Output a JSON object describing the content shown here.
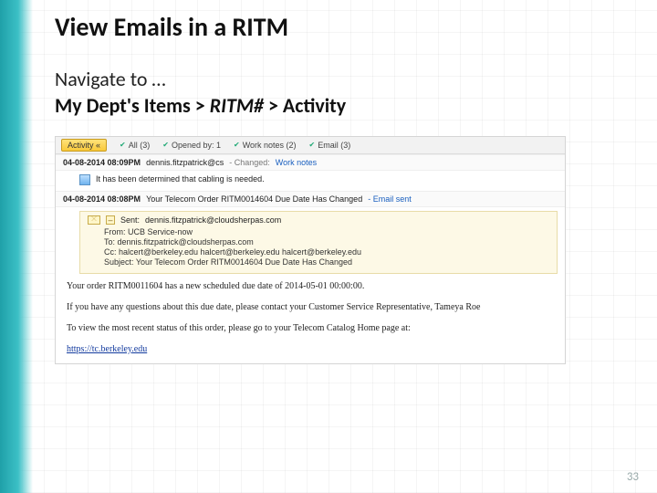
{
  "slide": {
    "title": "View Emails in a RITM",
    "nav_label": "Navigate to …",
    "nav_path_prefix": "My Dept's Items > ",
    "nav_path_italic": "RITM#",
    "nav_path_suffix": " > Activity",
    "page_number": "33"
  },
  "activity_header": {
    "button": "Activity «",
    "filters": [
      "All (3)",
      "Opened by: 1",
      "Work notes (2)",
      "Email (3)"
    ]
  },
  "entry1": {
    "timestamp": "04-08-2014 08:09PM",
    "user": "dennis.fitzpatrick@cs",
    "tag_prefix": "- Changed:",
    "tag_value": "Work notes",
    "body": "It has been determined that cabling is needed."
  },
  "entry2": {
    "timestamp": "04-08-2014 08:08PM",
    "subject": "Your Telecom Order RITM0014604 Due Date Has Changed",
    "tag": "- Email sent"
  },
  "email": {
    "sent": "dennis.fitzpatrick@cloudsherpas.com",
    "from": "UCB Service-now",
    "to": "dennis.fitzpatrick@cloudsherpas.com",
    "cc": "halcert@berkeley.edu halcert@berkeley.edu halcert@berkeley.edu",
    "subject": "Your Telecom Order RITM0014604 Due Date Has Changed"
  },
  "email_body": {
    "line1": "Your order RITM0011604 has a new scheduled due date of 2014-05-01 00:00:00.",
    "line2": "If you have any questions about this due date, please contact your Customer Service Representative, Tameya Roe",
    "line3": "To view the most recent status of this order, please go to your Telecom Catalog Home page at:",
    "link": "https://tc.berkeley.edu"
  }
}
